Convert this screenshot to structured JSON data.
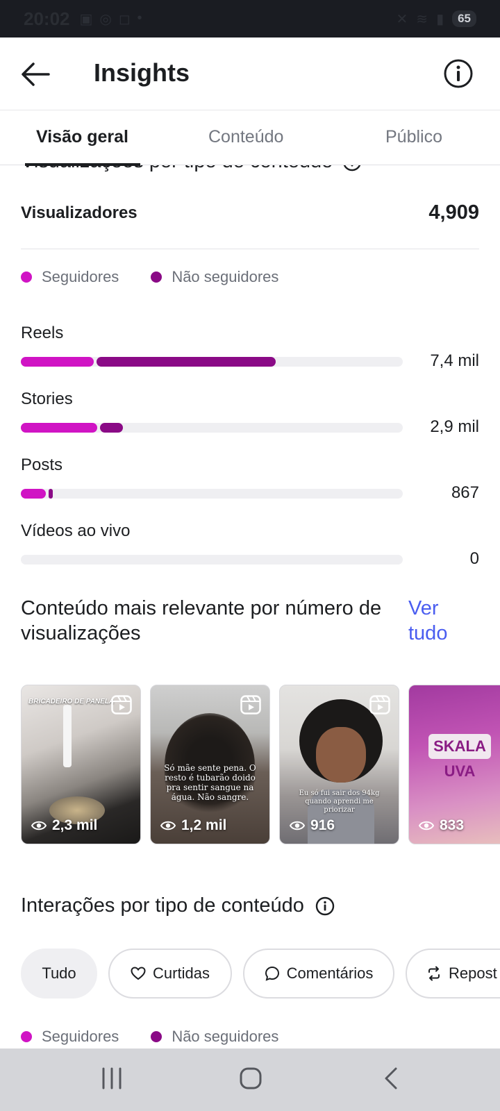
{
  "status_bar": {
    "time": "20:02",
    "battery": "65"
  },
  "header": {
    "title": "Insights"
  },
  "tabs": [
    {
      "label": "Visão geral"
    },
    {
      "label": "Conteúdo"
    },
    {
      "label": "Público"
    }
  ],
  "views_section": {
    "heading": "Visualizações por tipo de conteúdo",
    "viewers_label": "Visualizadores",
    "viewers_value": "4,909",
    "legend": [
      {
        "label": "Seguidores",
        "color": "#d014c4"
      },
      {
        "label": "Não seguidores",
        "color": "#8a0a86"
      }
    ],
    "bars": [
      {
        "label": "Reels",
        "value": "7,4 mil",
        "followers_fraction": 0.19,
        "nonfollowers_fraction": 0.47
      },
      {
        "label": "Stories",
        "value": "2,9 mil",
        "followers_fraction": 0.2,
        "nonfollowers_fraction": 0.06
      },
      {
        "label": "Posts",
        "value": "867",
        "followers_fraction": 0.065,
        "nonfollowers_fraction": 0.012
      },
      {
        "label": "Vídeos ao vivo",
        "value": "0",
        "followers_fraction": 0,
        "nonfollowers_fraction": 0
      }
    ]
  },
  "relevant_content": {
    "title": "Conteúdo mais relevante por número de visualizações",
    "see_all": "Ver tudo",
    "items": [
      {
        "views": "2,3 mil",
        "overlay_text": "BRICADEIRO DE PANELA"
      },
      {
        "views": "1,2 mil",
        "overlay_text": "Só mãe sente pena. O resto é tubarão doido pra sentir sangue na água. Não sangre."
      },
      {
        "views": "916",
        "overlay_text": "Eu só fui sair dos 94kg quando aprendi me priorizar"
      },
      {
        "views": "833",
        "overlay_text": "SKALA UVA"
      }
    ]
  },
  "interactions_section": {
    "heading": "Interações por tipo de conteúdo",
    "chips": [
      {
        "label": "Tudo",
        "icon": ""
      },
      {
        "label": "Curtidas",
        "icon": "heart-icon"
      },
      {
        "label": "Comentários",
        "icon": "comment-icon"
      },
      {
        "label": "Repost",
        "icon": "repost-icon"
      }
    ],
    "legend": [
      {
        "label": "Seguidores",
        "color": "#d014c4"
      },
      {
        "label": "Não seguidores",
        "color": "#8a0a86"
      }
    ]
  }
}
